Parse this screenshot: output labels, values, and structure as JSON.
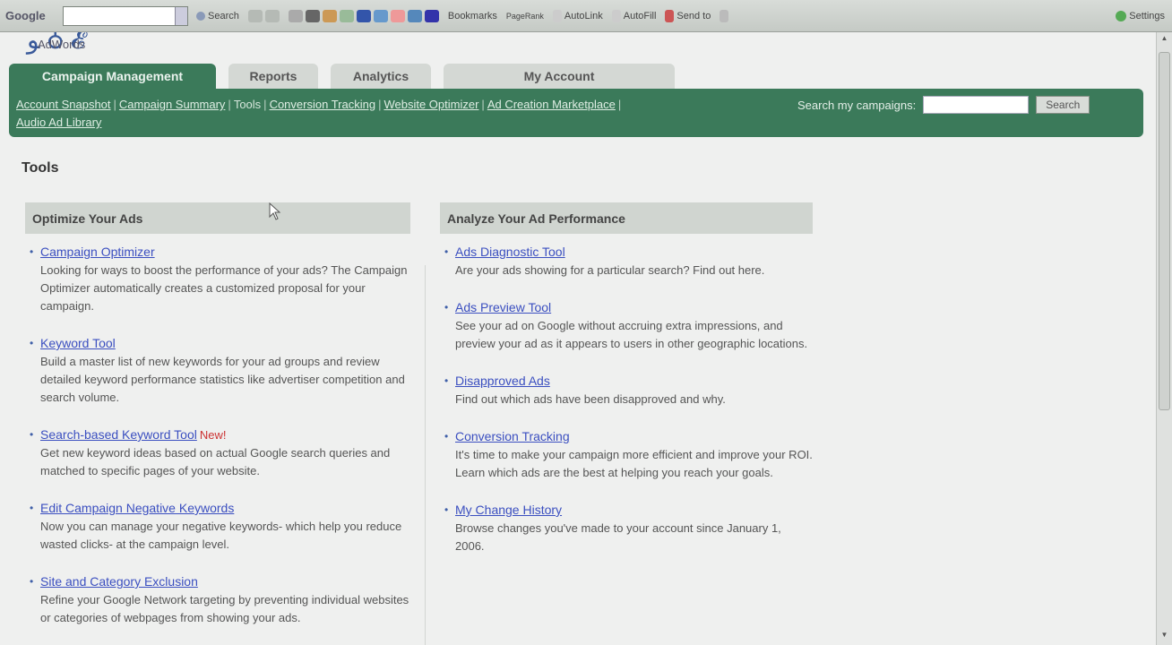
{
  "toolbar": {
    "google_label": "Google",
    "search_label": "Search",
    "bookmarks_label": "Bookmarks",
    "pagerank_label": "PageRank",
    "autolink_label": "AutoLink",
    "autofill_label": "AutoFill",
    "sendto_label": "Send to",
    "settings_label": "Settings"
  },
  "logo": {
    "sub": "AdWords"
  },
  "tabs": [
    {
      "label": "Campaign Management",
      "active": true
    },
    {
      "label": "Reports",
      "active": false
    },
    {
      "label": "Analytics",
      "active": false
    },
    {
      "label": "My Account",
      "active": false
    }
  ],
  "subnav": {
    "links": [
      "Account Snapshot",
      "Campaign Summary",
      "Tools",
      "Conversion Tracking",
      "Website Optimizer",
      "Ad Creation Marketplace",
      "Audio Ad Library"
    ],
    "search_label": "Search my campaigns:",
    "search_button": "Search"
  },
  "page_title": "Tools",
  "left_panel": {
    "title": "Optimize Your Ads",
    "tools": [
      {
        "name": "Campaign Optimizer",
        "desc": "Looking for ways to boost the performance of your ads? The Campaign Optimizer automatically creates a customized proposal for your campaign."
      },
      {
        "name": "Keyword Tool",
        "desc": "Build a master list of new keywords for your ad groups and review detailed keyword performance statistics like advertiser competition and search volume."
      },
      {
        "name": "Search-based Keyword Tool",
        "badge": "New!",
        "desc": "Get new keyword ideas based on actual Google search queries and matched to specific pages of your website."
      },
      {
        "name": "Edit Campaign Negative Keywords",
        "desc": "Now you can manage your negative keywords- which help you reduce wasted clicks- at the campaign level."
      },
      {
        "name": "Site and Category Exclusion",
        "desc": "Refine your Google Network targeting by preventing individual websites or categories of webpages from showing your ads."
      }
    ]
  },
  "right_panel": {
    "title": "Analyze Your Ad Performance",
    "tools": [
      {
        "name": "Ads Diagnostic Tool",
        "desc": "Are your ads showing for a particular search? Find out here."
      },
      {
        "name": "Ads Preview Tool",
        "desc": "See your ad on Google without accruing extra impressions, and preview your ad as it appears to users in other geographic locations."
      },
      {
        "name": "Disapproved Ads",
        "desc": "Find out which ads have been disapproved and why."
      },
      {
        "name": "Conversion Tracking",
        "desc": "It's time to make your campaign more efficient and improve your ROI. Learn which ads are the best at helping you reach your goals."
      },
      {
        "name": "My Change History",
        "desc": "Browse changes you've made to your account since January 1, 2006."
      }
    ]
  },
  "colors": {
    "brand_green": "#3b7a5a",
    "link_blue": "#3b4fc0",
    "new_red": "#cc3333"
  }
}
